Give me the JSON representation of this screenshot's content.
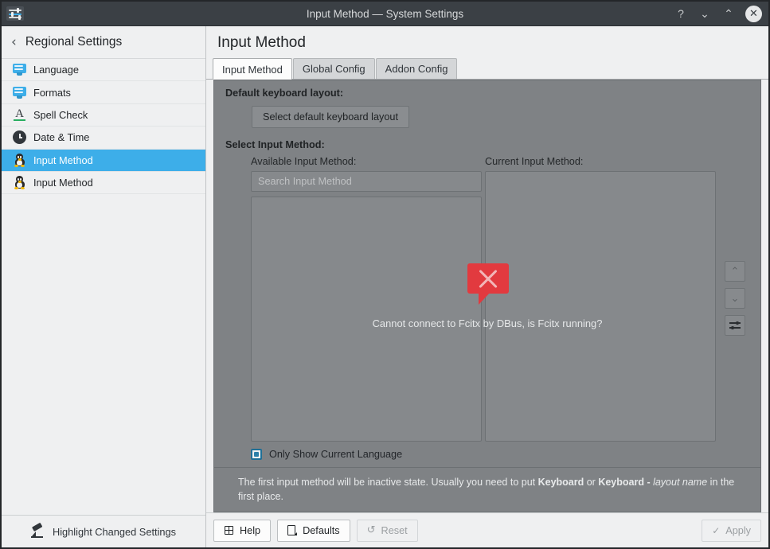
{
  "window": {
    "title": "Input Method — System Settings",
    "app_icon": "settings-sliders-icon",
    "buttons": {
      "help": "?",
      "minimize": "⌄",
      "maximize": "⌃",
      "close": "✕"
    }
  },
  "sidebar": {
    "back_glyph": "‹",
    "header_title": "Regional Settings",
    "items": [
      {
        "label": "Language",
        "icon": "monitor-icon",
        "active": false
      },
      {
        "label": "Formats",
        "icon": "monitor-icon",
        "active": false
      },
      {
        "label": "Spell Check",
        "icon": "spell-check-icon",
        "active": false
      },
      {
        "label": "Date & Time",
        "icon": "clock-icon",
        "active": false
      },
      {
        "label": "Input Method",
        "icon": "tux-icon",
        "active": true
      },
      {
        "label": "Input Method",
        "icon": "tux-icon",
        "active": false
      }
    ],
    "footer": {
      "label": "Highlight Changed Settings",
      "icon": "highlighter-pen-icon"
    }
  },
  "main": {
    "page_title": "Input Method",
    "tabs": [
      {
        "label": "Input Method",
        "active": true
      },
      {
        "label": "Global Config",
        "active": false
      },
      {
        "label": "Addon Config",
        "active": false
      }
    ],
    "default_keyboard_label": "Default keyboard layout:",
    "select_keyboard_button": "Select default keyboard layout",
    "select_input_method_label": "Select Input Method:",
    "available_label": "Available Input Method:",
    "current_label": "Current Input Method:",
    "search_placeholder": "Search Input Method",
    "search_value": "",
    "error": {
      "icon": "error-bubble-icon",
      "message": "Cannot connect to Fcitx by DBus, is Fcitx running?"
    },
    "side_buttons": [
      {
        "name": "move-up-button",
        "glyph": "⌃",
        "enabled": false
      },
      {
        "name": "move-down-button",
        "glyph": "⌄",
        "enabled": false
      },
      {
        "name": "configure-button",
        "glyph": "sliders-icon",
        "enabled": true
      }
    ],
    "only_show_current_language": {
      "label": "Only Show Current Language",
      "checked": true
    },
    "hint": {
      "part1": "The first input method will be inactive state. Usually you need to put ",
      "bold1": "Keyboard",
      "part2": " or ",
      "bold2": "Keyboard - ",
      "italic": "layout name",
      "part3": " in the first place."
    }
  },
  "bottom_bar": {
    "help": "Help",
    "defaults": "Defaults",
    "reset": "Reset",
    "apply": "Apply",
    "reset_enabled": false,
    "apply_enabled": false
  },
  "colors": {
    "accent": "#3daee9",
    "titlebar": "#3b4045",
    "panel": "#7f8285",
    "error_red": "#e23a3f",
    "checkbox": "#2b7fa8"
  }
}
